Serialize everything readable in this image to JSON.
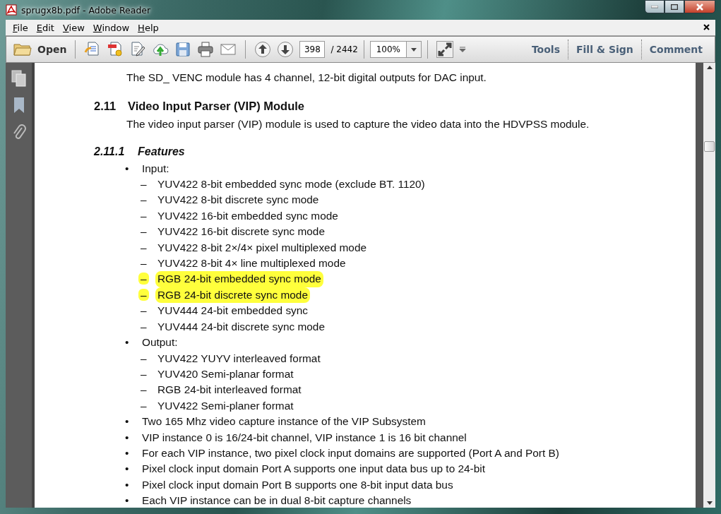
{
  "window": {
    "title": "sprugx8b.pdf - Adobe Reader"
  },
  "menu": [
    {
      "label": "File"
    },
    {
      "label": "Edit"
    },
    {
      "label": "View"
    },
    {
      "label": "Window"
    },
    {
      "label": "Help"
    }
  ],
  "toolbar": {
    "open_label": "Open",
    "page_number": "398",
    "page_total": "/ 2442",
    "zoom": "100%",
    "panes": [
      "Tools",
      "Fill & Sign",
      "Comment"
    ]
  },
  "list_markers": {
    "bullet": "•",
    "dash": "–"
  },
  "document": [
    {
      "kind": "para",
      "text": "The SD_ VENC module has 4 channel, 12-bit digital outputs for DAC input."
    },
    {
      "kind": "heading",
      "number": "2.11",
      "text": "Video Input Parser (VIP) Module"
    },
    {
      "kind": "para",
      "text": "The video input parser (VIP) module is used to capture the video data into the HDVPSS module."
    },
    {
      "kind": "subheading",
      "number": "2.11.1",
      "text": "Features"
    },
    {
      "kind": "bullet",
      "text": "Input:"
    },
    {
      "kind": "dash",
      "text": "YUV422 8-bit embedded sync mode (exclude BT. 1120)",
      "highlighted": false
    },
    {
      "kind": "dash",
      "text": "YUV422 8-bit discrete sync mode",
      "highlighted": false
    },
    {
      "kind": "dash",
      "text": "YUV422 16-bit embedded sync mode",
      "highlighted": false
    },
    {
      "kind": "dash",
      "text": "YUV422 16-bit discrete sync mode",
      "highlighted": false
    },
    {
      "kind": "dash",
      "text": "YUV422 8-bit 2×/4× pixel multiplexed mode",
      "highlighted": false
    },
    {
      "kind": "dash",
      "text": "YUV422 8-bit 4× line multiplexed mode",
      "highlighted": false
    },
    {
      "kind": "dash",
      "text": "RGB 24-bit embedded sync mode",
      "highlighted": true
    },
    {
      "kind": "dash",
      "text": "RGB 24-bit discrete sync mode",
      "highlighted": true
    },
    {
      "kind": "dash",
      "text": "YUV444 24-bit embedded sync",
      "highlighted": false
    },
    {
      "kind": "dash",
      "text": "YUV444 24-bit discrete sync mode",
      "highlighted": false
    },
    {
      "kind": "bullet",
      "text": "Output:"
    },
    {
      "kind": "dash",
      "text": "YUV422 YUYV interleaved format",
      "highlighted": false
    },
    {
      "kind": "dash",
      "text": "YUV420 Semi-planar format",
      "highlighted": false
    },
    {
      "kind": "dash",
      "text": "RGB 24-bit interleaved format",
      "highlighted": false
    },
    {
      "kind": "dash",
      "text": "YUV422 Semi-planer format",
      "highlighted": false
    },
    {
      "kind": "bullet",
      "text": "Two 165 Mhz video capture instance of the VIP Subsystem"
    },
    {
      "kind": "bullet",
      "text": "VIP instance 0 is 16/24-bit channel, VIP instance 1 is 16 bit channel"
    },
    {
      "kind": "bullet",
      "text": "For each VIP instance, two pixel clock input domains are supported (Port A and Port B)"
    },
    {
      "kind": "bullet",
      "text": "Pixel clock input domain Port A supports one input data bus up to 24-bit"
    },
    {
      "kind": "bullet",
      "text": "Pixel clock input domain Port B supports one 8-bit input data bus"
    },
    {
      "kind": "bullet",
      "text": "Each VIP instance can be in dual 8-bit capture channels"
    }
  ]
}
